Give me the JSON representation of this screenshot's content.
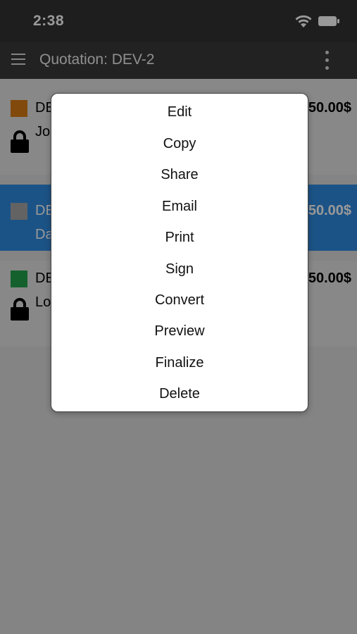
{
  "status_bar": {
    "time": "2:38",
    "wifi_icon": "wifi-icon",
    "battery_icon": "battery-icon"
  },
  "app_bar": {
    "menu_icon": "hamburger-menu-icon",
    "title": "Quotation: DEV-2",
    "more_icon": "more-vertical-icon"
  },
  "rows": [
    {
      "code": "DE",
      "client": "Jo",
      "amount": "50.00$",
      "color": "#d97a14",
      "locked": true,
      "selected": false
    },
    {
      "code": "DE",
      "client": "Da",
      "amount": "50.00$",
      "color": "#a6a6a6",
      "locked": false,
      "selected": true
    },
    {
      "code": "DE",
      "client": "Lo",
      "amount": "50.00$",
      "color": "#23a24d",
      "locked": true,
      "selected": false
    }
  ],
  "menu": {
    "items": [
      "Edit",
      "Copy",
      "Share",
      "Email",
      "Print",
      "Sign",
      "Convert",
      "Preview",
      "Finalize",
      "Delete"
    ]
  }
}
